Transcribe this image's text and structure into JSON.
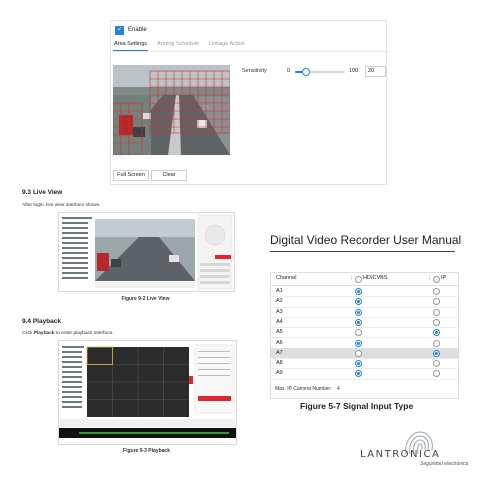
{
  "settings_panel": {
    "enable_label": "Enable",
    "tabs": [
      {
        "label": "Area Settings",
        "active": true
      },
      {
        "label": "Arming Schedule",
        "active": false
      },
      {
        "label": "Linkage Action",
        "active": false
      }
    ],
    "sensitivity": {
      "label": "Sensitivity",
      "min": "0",
      "max": "100",
      "value": "20",
      "level_percent": 20
    },
    "full_screen_label": "Full Screen",
    "clear_label": "Clear"
  },
  "live_view_section": {
    "heading": "9.3 Live View",
    "text": "After login, live view interface shows.",
    "caption": "Figure 9-2 Live View"
  },
  "playback_section": {
    "heading": "9.4 Playback",
    "text_prefix": "Click ",
    "text_bold": "Playback",
    "text_suffix": " to enter playback interface.",
    "caption": "Figure 9-3 Playback"
  },
  "manual_title": "Digital Video Recorder User Manual",
  "signal_table": {
    "headers": {
      "channel": "Channel",
      "hdcvbs": "HD/CVBS",
      "ip": "IP"
    },
    "rows": [
      {
        "channel": "A1",
        "selected": "hd"
      },
      {
        "channel": "A2",
        "selected": "hd"
      },
      {
        "channel": "A3",
        "selected": "hd"
      },
      {
        "channel": "A4",
        "selected": "hd"
      },
      {
        "channel": "A5",
        "selected": "ip"
      },
      {
        "channel": "A6",
        "selected": "hd"
      },
      {
        "channel": "A7",
        "selected": "ip",
        "highlight": true
      },
      {
        "channel": "A8",
        "selected": "hd"
      },
      {
        "channel": "A9",
        "selected": "hd"
      }
    ],
    "footer_label": "Max. IP Camera Number:",
    "footer_value": "4"
  },
  "figure_5_7_caption": "Figure 5-7 Signal Input Type",
  "brand": {
    "name": "LANTRONICA",
    "tagline": "Seguridad electrónica"
  },
  "colors": {
    "accent": "#2a7fd8",
    "grid_red": "#e0262b"
  }
}
